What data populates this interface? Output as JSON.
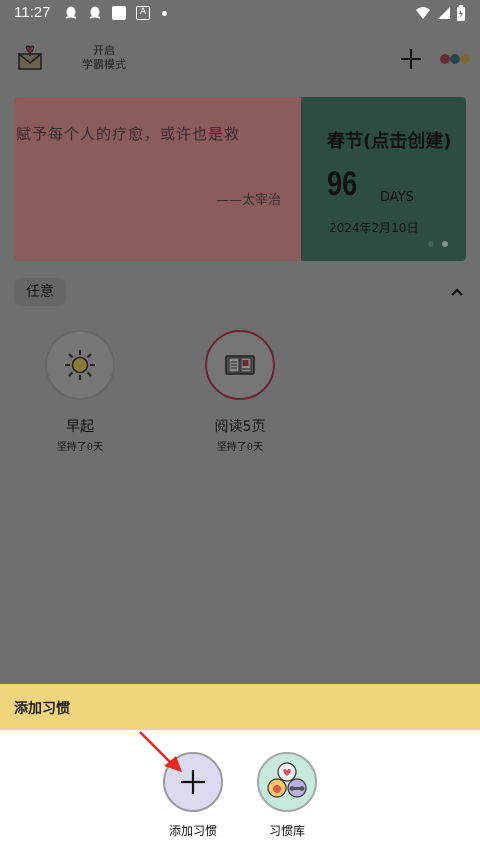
{
  "status_bar": {
    "time": "11:27",
    "badge_letter": "A"
  },
  "header": {
    "mode_toggle_line1": "开启",
    "mode_toggle_line2": "学霸模式"
  },
  "banner": {
    "quote": "赋予每个人的疗愈，或许也是救",
    "author": "——太宰治",
    "event_title": "春节(点击创建)",
    "event_count": "96",
    "event_unit": "DAYS",
    "event_date": "2024年2月10日"
  },
  "filter": {
    "chip_label": "任意"
  },
  "habits": [
    {
      "name": "早起",
      "streak": "坚持了0天",
      "icon": "sun-icon"
    },
    {
      "name": "阅读5页",
      "streak": "坚持了0天",
      "icon": "book-icon"
    }
  ],
  "sheet": {
    "title": "添加习惯",
    "options": [
      {
        "label": "添加习惯",
        "icon": "plus-icon"
      },
      {
        "label": "习惯库",
        "icon": "habit-library-icon"
      }
    ]
  },
  "colors": {
    "overlay_bg": "#6f6f6f",
    "quote_panel": "#8a5c5c",
    "event_panel": "#2e4d42",
    "sheet_header": "#f0d57c",
    "arrow": "#e8281e"
  }
}
